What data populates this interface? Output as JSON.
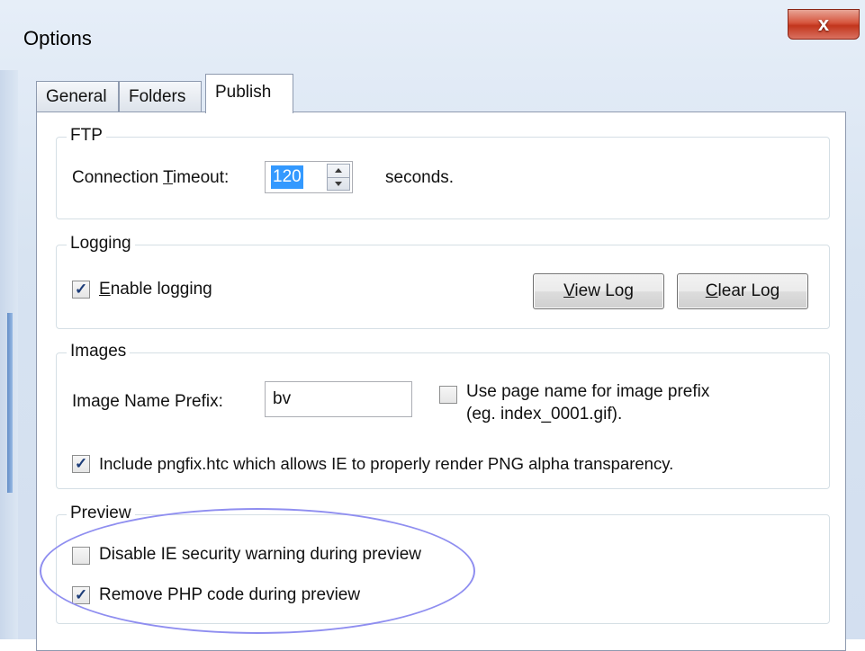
{
  "window": {
    "title": "Options",
    "close_glyph": "x"
  },
  "tabs": [
    {
      "label": "General"
    },
    {
      "label": "Folders"
    },
    {
      "label": "Publish"
    }
  ],
  "ftp": {
    "group_label": "FTP",
    "timeout_label_pre": "Connection ",
    "timeout_label_key": "T",
    "timeout_label_post": "imeout:",
    "timeout_value": "120",
    "unit": "seconds."
  },
  "logging": {
    "group_label": "Logging",
    "enable_key": "E",
    "enable_rest": "nable logging",
    "enable_checked": true,
    "view_key": "V",
    "view_rest": "iew Log",
    "clear_key": "C",
    "clear_rest": "lear Log"
  },
  "images": {
    "group_label": "Images",
    "prefix_label": "Image Name Prefix:",
    "prefix_value": "bv",
    "use_page_name_line1": "Use page name for image prefix",
    "use_page_name_line2": "(eg. index_0001.gif).",
    "use_page_name_checked": false,
    "pngfix_label": "Include pngfix.htc which allows IE to properly render PNG alpha transparency.",
    "pngfix_checked": true
  },
  "preview": {
    "group_label": "Preview",
    "disable_warning_label": "Disable IE security warning during preview",
    "disable_warning_checked": false,
    "remove_php_label": "Remove PHP code during preview",
    "remove_php_checked": true
  },
  "colors": {
    "selection": "#3399ff",
    "annotation_ellipse": "#8f8ef0",
    "close_button": "#c2351c"
  },
  "icons": {
    "close": "close-icon",
    "spin_up": "spin-up-arrow-icon",
    "spin_down": "spin-down-arrow-icon",
    "check": "checkmark-icon"
  }
}
